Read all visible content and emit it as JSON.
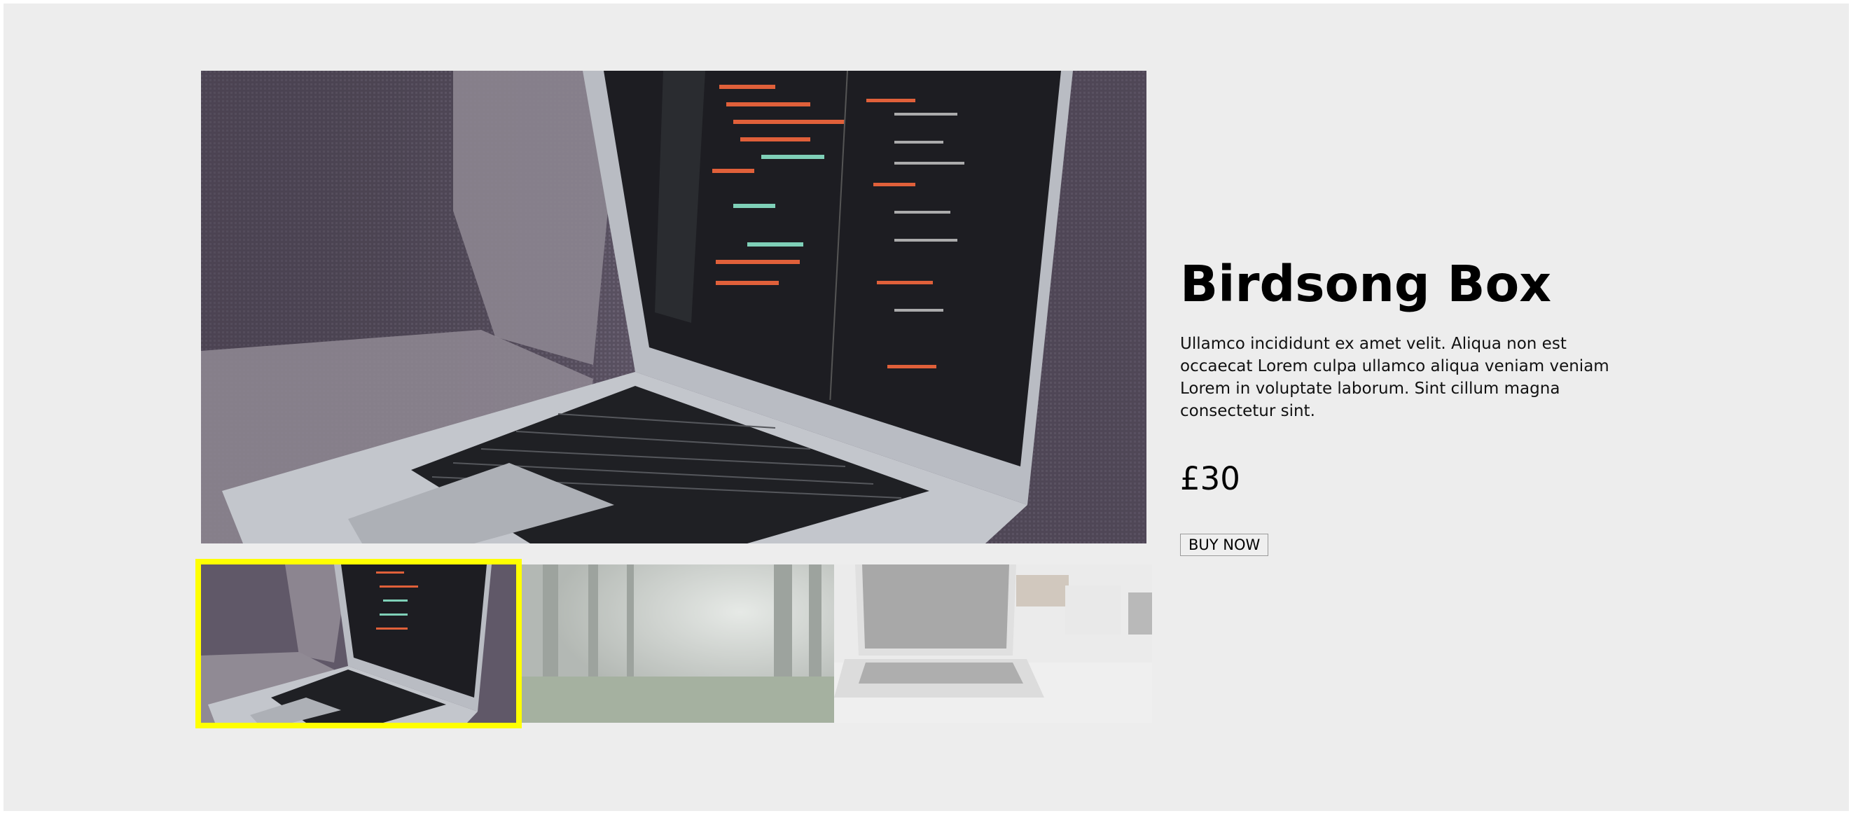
{
  "product": {
    "title": "Birdsong Box",
    "description": "Ullamco incididunt ex amet velit. Aliqua non est occaecat Lorem culpa ullamco aliqua veniam veniam Lorem in voluptate laborum. Sint cillum magna consectetur sint.",
    "price": "£30",
    "buy_label": "BUY NOW"
  },
  "gallery": {
    "selected_index": 0,
    "thumbnails": [
      {
        "subject": "laptop-code-on-couch",
        "selected": true
      },
      {
        "subject": "misty-forest",
        "selected": false
      },
      {
        "subject": "laptop-on-white-desk",
        "selected": false
      }
    ],
    "selection_color": "#ffff00"
  },
  "colors": {
    "page_background": "#ededed"
  }
}
